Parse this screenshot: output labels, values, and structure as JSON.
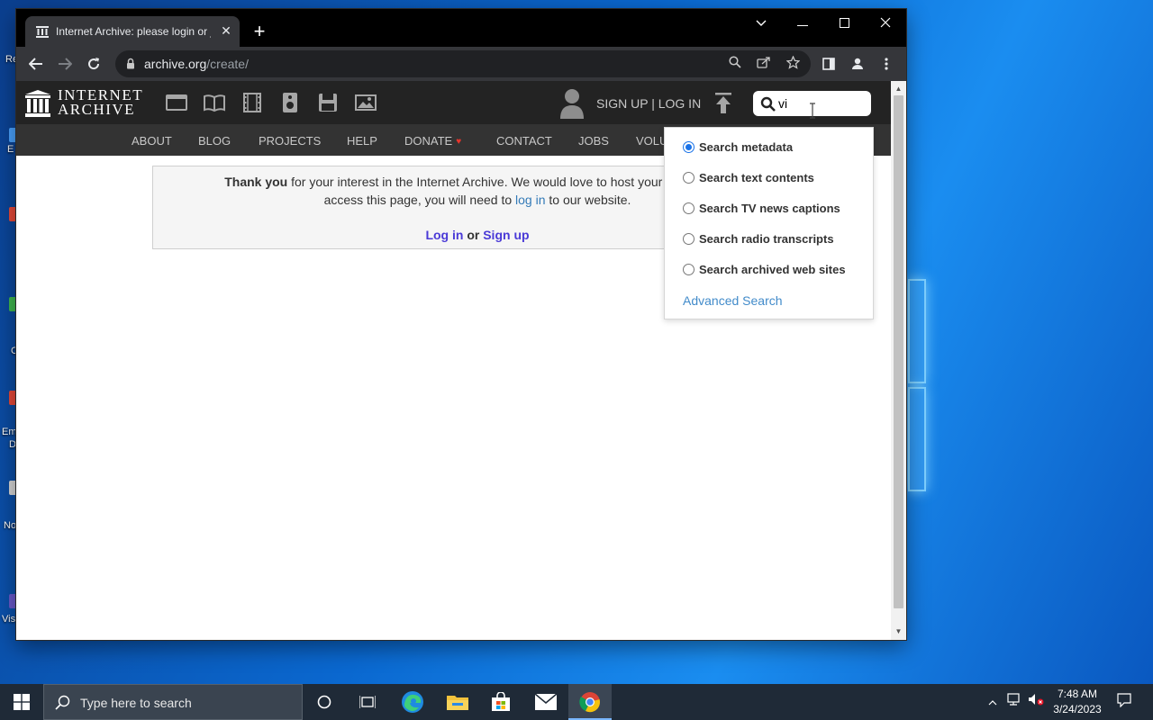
{
  "desktop": {
    "icons": [
      {
        "label": "Re"
      },
      {
        "label": "E"
      },
      {
        "label": ""
      },
      {
        "label": "C"
      },
      {
        "label": "Em"
      },
      {
        "label": "D"
      },
      {
        "label": "No"
      },
      {
        "label": "Vis"
      }
    ]
  },
  "browser": {
    "tab_title": "Internet Archive: please login or j",
    "new_tab": "+",
    "url_domain": "archive.org",
    "url_path": "/create/"
  },
  "ia": {
    "logo_line1": "INTERNET",
    "logo_line2": "ARCHIVE",
    "signup_login": "SIGN UP | LOG IN",
    "search_value": "vi",
    "nav": [
      "ABOUT",
      "BLOG",
      "PROJECTS",
      "HELP",
      "DONATE",
      "CONTACT",
      "JOBS",
      "VOLU"
    ],
    "notice": {
      "bold_start": "Thank you",
      "line1_rest": " for your interest in the Internet Archive. We would love to host your digital artifa",
      "line2_a": "access this page, you will need to ",
      "line2_link": "log in",
      "line2_b": " to our website.",
      "login_link": "Log in",
      "or": " or ",
      "signup_link": "Sign up"
    },
    "search_options": [
      {
        "label": "Search metadata",
        "selected": true
      },
      {
        "label": "Search text contents",
        "selected": false
      },
      {
        "label": "Search TV news captions",
        "selected": false
      },
      {
        "label": "Search radio transcripts",
        "selected": false
      },
      {
        "label": "Search archived web sites",
        "selected": false
      }
    ],
    "advanced_search": "Advanced Search"
  },
  "taskbar": {
    "search_placeholder": "Type here to search",
    "time": "7:48 AM",
    "date": "3/24/2023"
  },
  "colors": {
    "ia_header": "#232323",
    "ia_nav": "#333333",
    "link": "#428bca",
    "radio_selected": "#1a73e8",
    "donate_heart": "#e8352c"
  }
}
